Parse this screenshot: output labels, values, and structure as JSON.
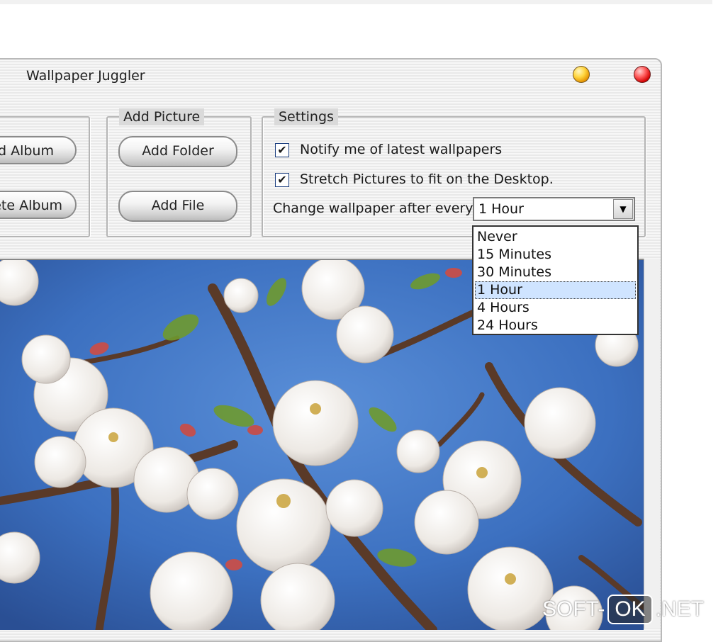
{
  "window": {
    "title": "Wallpaper Juggler"
  },
  "albums": {
    "add_album_label": "ld Album",
    "delete_album_label": "ete Album"
  },
  "add_picture": {
    "legend": "Add Picture",
    "add_folder_label": "Add Folder",
    "add_file_label": "Add File"
  },
  "settings": {
    "legend": "Settings",
    "notify": {
      "label": "Notify me of latest wallpapers",
      "checked": true,
      "mark": "✔"
    },
    "stretch": {
      "label": "Stretch Pictures to fit on the Desktop.",
      "checked": true,
      "mark": "✔"
    },
    "interval_label": "Change wallpaper after every",
    "interval_value": "1 Hour",
    "interval_options": [
      "Never",
      "15 Minutes",
      "30 Minutes",
      "1 Hour",
      "4 Hours",
      "24 Hours"
    ],
    "selected_index": 3,
    "dropdown_arrow": "▼"
  },
  "watermark": {
    "left": "SOFT-",
    "box": "OK",
    "right": ".NET"
  },
  "colors": {
    "sky": "#3f78c8",
    "selection": "#cfe4ff",
    "blossom": "#f5f2ee",
    "branch": "#5a3a28"
  },
  "icons": {
    "minimize": "yellow-orb",
    "close": "red-orb",
    "checkbox": "check-icon",
    "combo": "chevron-down-icon"
  }
}
